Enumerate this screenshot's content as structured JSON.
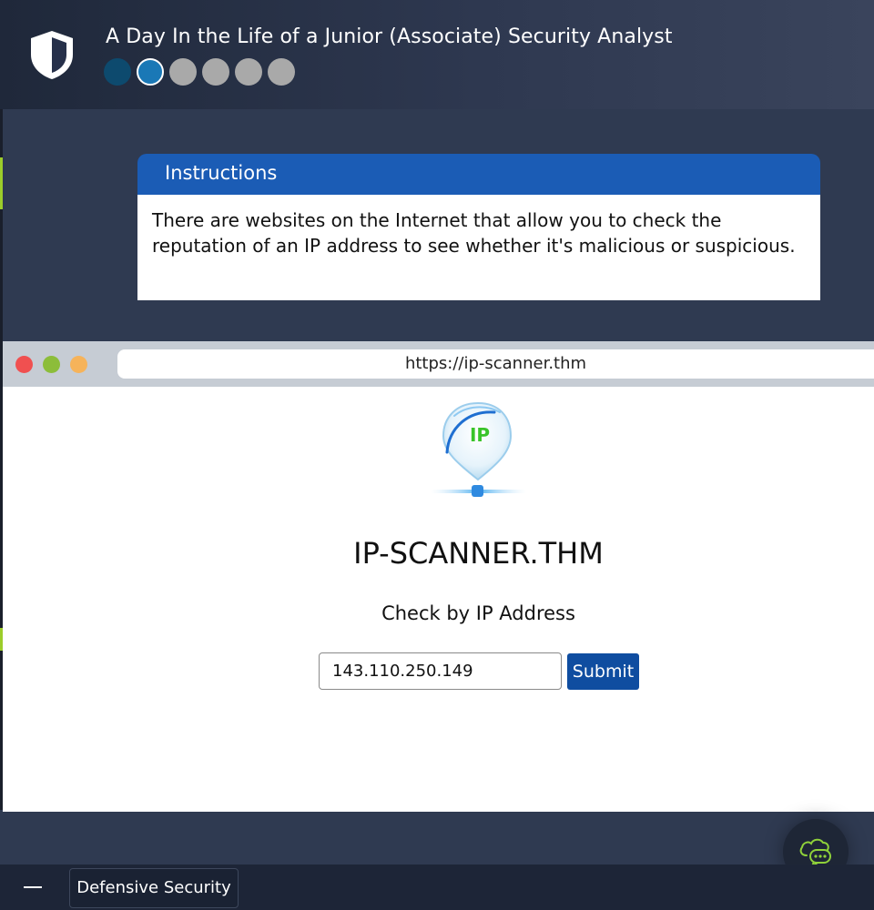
{
  "header": {
    "title": "A Day In the Life of a Junior (Associate) Security Analyst",
    "progress_steps": 6,
    "progress_completed": 1,
    "progress_current_index": 1,
    "logo_icon": "shield-icon"
  },
  "instructions": {
    "heading": "Instructions",
    "body": "There are websites on the Internet that allow you to check the reputation of an IP address to see whether it's malicious or suspicious."
  },
  "browser": {
    "url": "https://ip-scanner.thm",
    "window_buttons": [
      "close",
      "minimize",
      "maximize"
    ],
    "site": {
      "logo_text": "IP",
      "title": "IP-SCANNER.THM",
      "subtitle": "Check by IP Address",
      "ip_value": "143.110.250.149",
      "submit_label": "Submit"
    }
  },
  "footer": {
    "minimize_icon": "minus-icon",
    "category_label": "Defensive Security",
    "chat_icon": "chat-cloud-icon"
  },
  "colors": {
    "header_bg": "#1f283a",
    "page_bg": "#2f3a51",
    "instructions_header": "#1b5cb5",
    "progress_done": "#0d4a6e",
    "progress_current": "#1a78b6",
    "progress_pending": "#a9a9a9",
    "submit_button": "#0f4da0",
    "accent_green": "#9ccd2a"
  }
}
